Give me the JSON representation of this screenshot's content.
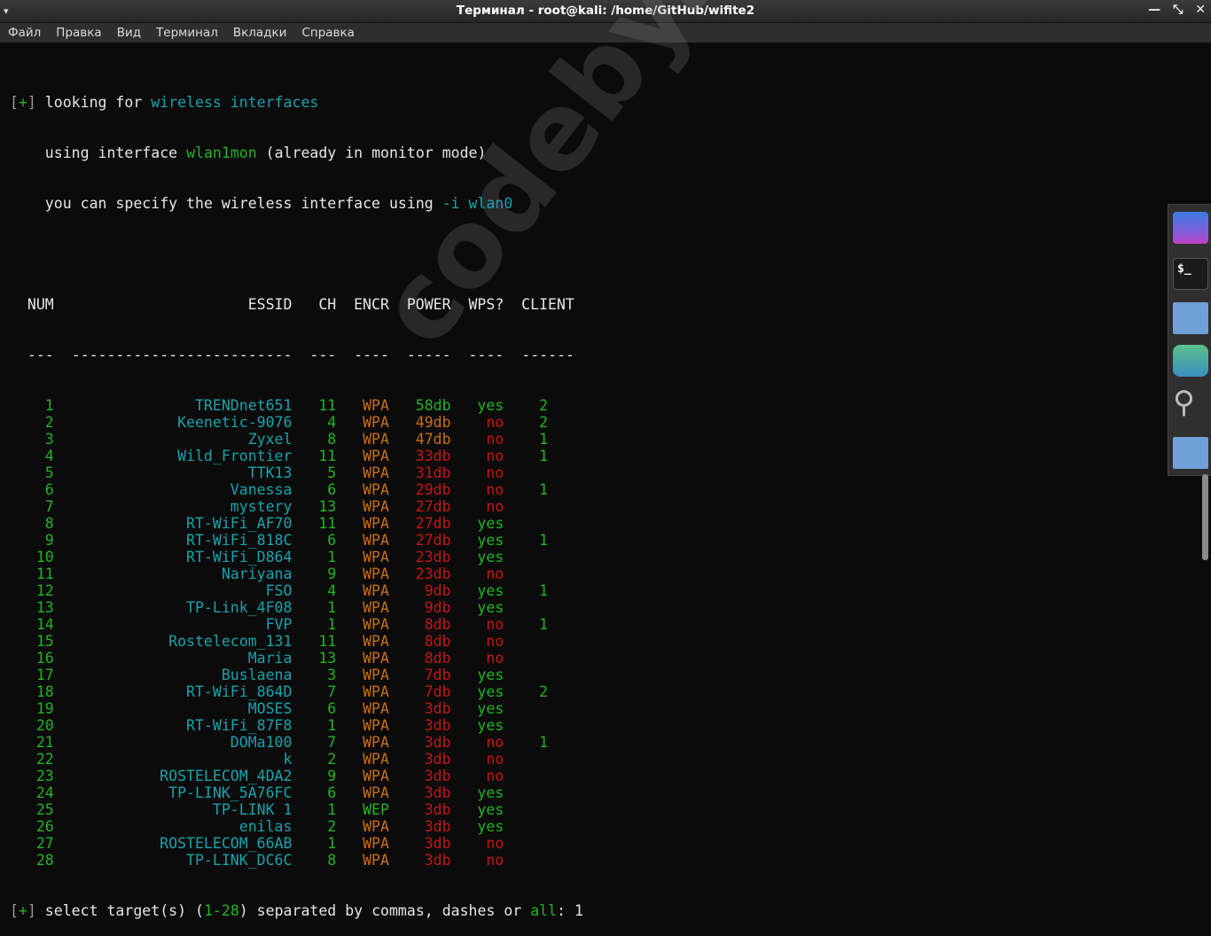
{
  "window": {
    "title": "Терминал - root@kali: /home/GitHub/wifite2",
    "menu_arrow": "▾",
    "minimize": "—",
    "restore": "⤡",
    "close": "✕"
  },
  "menu": [
    "Файл",
    "Правка",
    "Вид",
    "Терминал",
    "Вкладки",
    "Справка"
  ],
  "intro": {
    "bracket_open": "[",
    "plus": "+",
    "bracket_close": "]",
    "l1a": " looking for ",
    "l1b": "wireless interfaces",
    "l2a": "    using interface ",
    "l2b": "wlan1mon",
    "l2c": " (already in monitor mode)",
    "l3a": "    you can specify the wireless interface using ",
    "l3b": "-i wlan0"
  },
  "table": {
    "headers": {
      "num": "NUM",
      "essid": "ESSID",
      "ch": "CH",
      "encr": "ENCR",
      "power": "POWER",
      "wps": "WPS?",
      "client": "CLIENT"
    },
    "dashes": "  ---  -------------------------  ---  ----  -----  ----  ------",
    "rows": [
      {
        "num": "1",
        "essid": "TRENDnet651",
        "ch": "11",
        "encr": "WPA",
        "power": "58db",
        "wps": "yes",
        "client": "2"
      },
      {
        "num": "2",
        "essid": "Keenetic-9076",
        "ch": "4",
        "encr": "WPA",
        "power": "49db",
        "wps": "no",
        "client": "2"
      },
      {
        "num": "3",
        "essid": "Zyxel",
        "ch": "8",
        "encr": "WPA",
        "power": "47db",
        "wps": "no",
        "client": "1"
      },
      {
        "num": "4",
        "essid": "Wild_Frontier",
        "ch": "11",
        "encr": "WPA",
        "power": "33db",
        "wps": "no",
        "client": "1"
      },
      {
        "num": "5",
        "essid": "TTK13",
        "ch": "5",
        "encr": "WPA",
        "power": "31db",
        "wps": "no",
        "client": ""
      },
      {
        "num": "6",
        "essid": "Vanessa",
        "ch": "6",
        "encr": "WPA",
        "power": "29db",
        "wps": "no",
        "client": "1"
      },
      {
        "num": "7",
        "essid": "mystery",
        "ch": "13",
        "encr": "WPA",
        "power": "27db",
        "wps": "no",
        "client": ""
      },
      {
        "num": "8",
        "essid": "RT-WiFi_AF70",
        "ch": "11",
        "encr": "WPA",
        "power": "27db",
        "wps": "yes",
        "client": ""
      },
      {
        "num": "9",
        "essid": "RT-WiFi_818C",
        "ch": "6",
        "encr": "WPA",
        "power": "27db",
        "wps": "yes",
        "client": "1"
      },
      {
        "num": "10",
        "essid": "RT-WiFi_D864",
        "ch": "1",
        "encr": "WPA",
        "power": "23db",
        "wps": "yes",
        "client": ""
      },
      {
        "num": "11",
        "essid": "Nariyana",
        "ch": "9",
        "encr": "WPA",
        "power": "23db",
        "wps": "no",
        "client": ""
      },
      {
        "num": "12",
        "essid": "FSO",
        "ch": "4",
        "encr": "WPA",
        "power": "9db",
        "wps": "yes",
        "client": "1"
      },
      {
        "num": "13",
        "essid": "TP-Link_4F08",
        "ch": "1",
        "encr": "WPA",
        "power": "9db",
        "wps": "yes",
        "client": ""
      },
      {
        "num": "14",
        "essid": "FVP",
        "ch": "1",
        "encr": "WPA",
        "power": "8db",
        "wps": "no",
        "client": "1"
      },
      {
        "num": "15",
        "essid": "Rostelecom_131",
        "ch": "11",
        "encr": "WPA",
        "power": "8db",
        "wps": "no",
        "client": ""
      },
      {
        "num": "16",
        "essid": "Maria",
        "ch": "13",
        "encr": "WPA",
        "power": "8db",
        "wps": "no",
        "client": ""
      },
      {
        "num": "17",
        "essid": "Buslaena",
        "ch": "3",
        "encr": "WPA",
        "power": "7db",
        "wps": "yes",
        "client": ""
      },
      {
        "num": "18",
        "essid": "RT-WiFi_864D",
        "ch": "7",
        "encr": "WPA",
        "power": "7db",
        "wps": "yes",
        "client": "2"
      },
      {
        "num": "19",
        "essid": "MOSES",
        "ch": "6",
        "encr": "WPA",
        "power": "3db",
        "wps": "yes",
        "client": ""
      },
      {
        "num": "20",
        "essid": "RT-WiFi_87F8",
        "ch": "1",
        "encr": "WPA",
        "power": "3db",
        "wps": "yes",
        "client": ""
      },
      {
        "num": "21",
        "essid": "DOMa100",
        "ch": "7",
        "encr": "WPA",
        "power": "3db",
        "wps": "no",
        "client": "1"
      },
      {
        "num": "22",
        "essid": "k",
        "ch": "2",
        "encr": "WPA",
        "power": "3db",
        "wps": "no",
        "client": ""
      },
      {
        "num": "23",
        "essid": "ROSTELECOM_4DA2",
        "ch": "9",
        "encr": "WPA",
        "power": "3db",
        "wps": "no",
        "client": ""
      },
      {
        "num": "24",
        "essid": "TP-LINK_5A76FC",
        "ch": "6",
        "encr": "WPA",
        "power": "3db",
        "wps": "yes",
        "client": ""
      },
      {
        "num": "25",
        "essid": "TP-LINK 1",
        "ch": "1",
        "encr": "WEP",
        "power": "3db",
        "wps": "yes",
        "client": ""
      },
      {
        "num": "26",
        "essid": "enilas",
        "ch": "2",
        "encr": "WPA",
        "power": "3db",
        "wps": "yes",
        "client": ""
      },
      {
        "num": "27",
        "essid": "ROSTELECOM_66AB",
        "ch": "1",
        "encr": "WPA",
        "power": "3db",
        "wps": "no",
        "client": ""
      },
      {
        "num": "28",
        "essid": "TP-LINK_DC6C",
        "ch": "8",
        "encr": "WPA",
        "power": "3db",
        "wps": "no",
        "client": ""
      }
    ]
  },
  "prompt": {
    "a": " select target(s) (",
    "range": "1-28",
    "b": ") separated by commas, dashes or ",
    "all": "all",
    "c": ": ",
    "input": "1"
  },
  "watermark": "codeby.net",
  "colors": {
    "green": "#22b422",
    "cyan": "#17a3ad",
    "orange": "#c86e12",
    "red": "#c41616"
  }
}
